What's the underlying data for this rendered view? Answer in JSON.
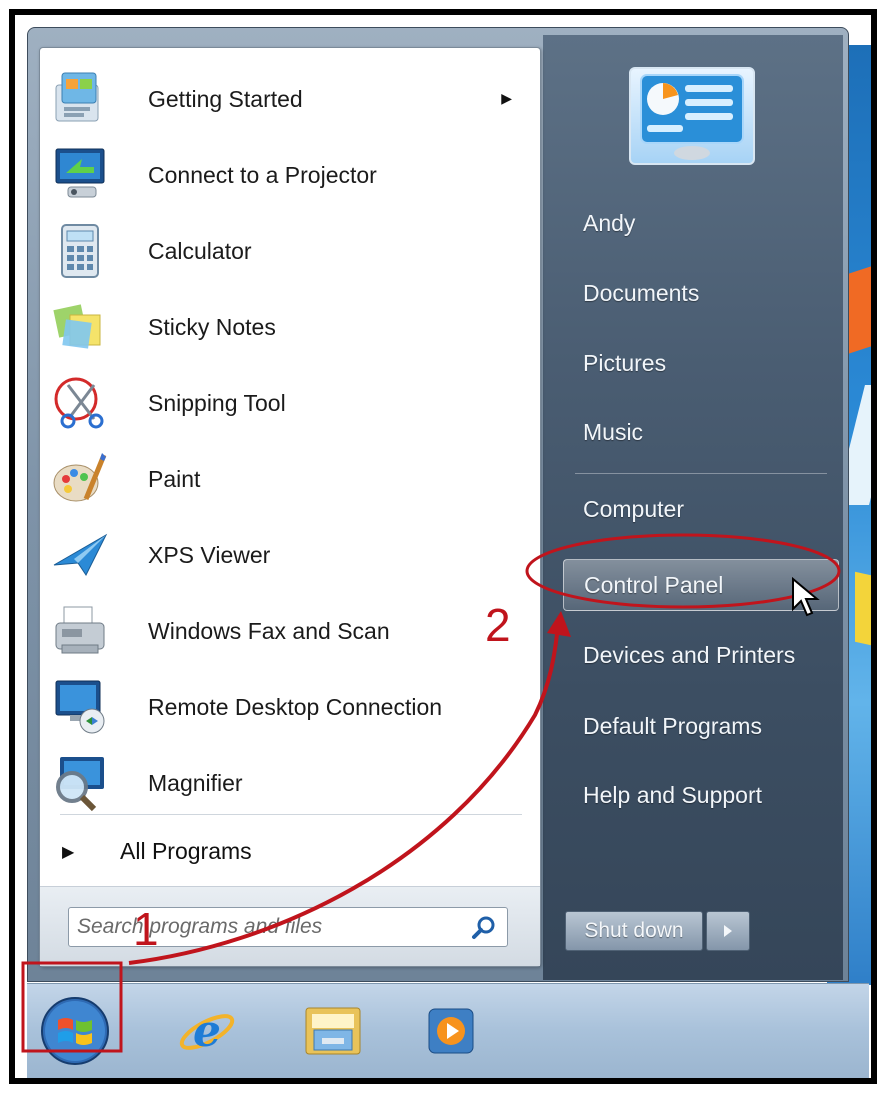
{
  "programs": [
    {
      "label": "Getting Started",
      "icon": "getting-started-icon",
      "has_submenu": true
    },
    {
      "label": "Connect to a Projector",
      "icon": "projector-icon"
    },
    {
      "label": "Calculator",
      "icon": "calculator-icon"
    },
    {
      "label": "Sticky Notes",
      "icon": "sticky-notes-icon"
    },
    {
      "label": "Snipping Tool",
      "icon": "snipping-tool-icon"
    },
    {
      "label": "Paint",
      "icon": "paint-icon"
    },
    {
      "label": "XPS Viewer",
      "icon": "xps-viewer-icon"
    },
    {
      "label": "Windows Fax and Scan",
      "icon": "fax-scan-icon"
    },
    {
      "label": "Remote Desktop Connection",
      "icon": "remote-desktop-icon"
    },
    {
      "label": "Magnifier",
      "icon": "magnifier-icon"
    }
  ],
  "all_programs": {
    "label": "All Programs"
  },
  "search": {
    "placeholder": "Search programs and files"
  },
  "places": [
    {
      "label": "Andy"
    },
    {
      "label": "Documents"
    },
    {
      "label": "Pictures"
    },
    {
      "label": "Music"
    },
    {
      "label": "Computer"
    },
    {
      "label": "Control Panel",
      "highlighted": true
    },
    {
      "label": "Devices and Printers"
    },
    {
      "label": "Default Programs"
    },
    {
      "label": "Help and Support"
    }
  ],
  "shutdown": {
    "label": "Shut down"
  },
  "annotations": {
    "step1": "1",
    "step2": "2",
    "color": "#c0141c"
  },
  "colors": {
    "right_pane": "#4a5d72",
    "left_pane": "#ffffff",
    "taskbar": "#a8c1da",
    "annotation": "#c0141c"
  }
}
